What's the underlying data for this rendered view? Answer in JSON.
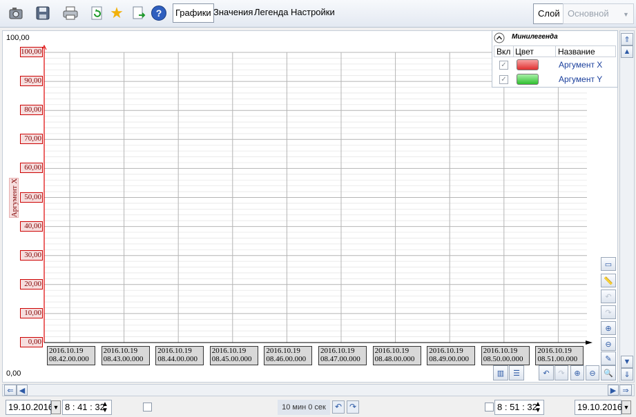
{
  "toolbar": {
    "icons": [
      {
        "name": "camera-icon",
        "glyph": "📷"
      },
      {
        "name": "save-icon",
        "glyph": "💾"
      },
      {
        "name": "print-icon",
        "glyph": "🖶"
      },
      {
        "name": "refresh-icon",
        "glyph": "🔄"
      },
      {
        "name": "star-icon",
        "glyph": "★"
      },
      {
        "name": "export-icon",
        "glyph": "🗎"
      },
      {
        "name": "help-icon",
        "glyph": "?"
      }
    ],
    "tabs": [
      "Графики",
      "Значения",
      "Легенда",
      "Настройки"
    ],
    "layer_label": "Слой",
    "layer_value": "Основной"
  },
  "chart_data": {
    "type": "line",
    "ylabel": "Аргумент X",
    "ylim": [
      0,
      100
    ],
    "yticks": [
      "100,00",
      "90,00",
      "80,00",
      "70,00",
      "60,00",
      "50,00",
      "40,00",
      "30,00",
      "20,00",
      "10,00",
      "0,00"
    ],
    "y_top_label": "100,00",
    "y_bottom_label": "0,00",
    "xticks": [
      [
        "2016.10.19",
        "08.42.00.000"
      ],
      [
        "2016.10.19",
        "08.43.00.000"
      ],
      [
        "2016.10.19",
        "08.44.00.000"
      ],
      [
        "2016.10.19",
        "08.45.00.000"
      ],
      [
        "2016.10.19",
        "08.46.00.000"
      ],
      [
        "2016.10.19",
        "08.47.00.000"
      ],
      [
        "2016.10.19",
        "08.48.00.000"
      ],
      [
        "2016.10.19",
        "08.49.00.000"
      ],
      [
        "2016.10.19",
        "08.50.00.000"
      ],
      [
        "2016.10.19",
        "08.51.00.000"
      ]
    ],
    "series": [
      {
        "name": "Аргумент X",
        "color": "#e03030",
        "values": []
      },
      {
        "name": "Аргумент Y",
        "color": "#30c030",
        "values": []
      }
    ],
    "grid": true
  },
  "minilegend": {
    "title": "Минилегенда",
    "col_on": "Вкл",
    "col_color": "Цвет",
    "col_name": "Название",
    "rows": [
      {
        "name": "Аргумент X",
        "color": "#e84040",
        "checked": true
      },
      {
        "name": "Аргумент Y",
        "color": "#40d040",
        "checked": true
      }
    ]
  },
  "bottom": {
    "start_date": "19.10.2016",
    "start_time": "8 : 41 : 32",
    "interval": "10 мин 0 сек",
    "end_time": "8 : 51 : 32",
    "end_date": "19.10.2016"
  }
}
